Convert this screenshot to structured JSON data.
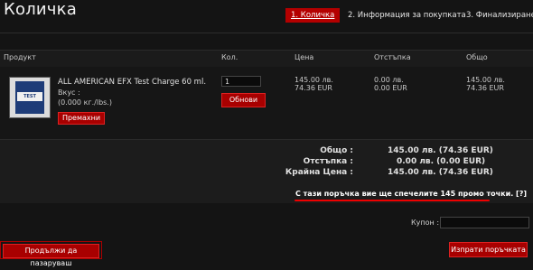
{
  "page": {
    "title": "Количка"
  },
  "steps": [
    {
      "label": "1. Количка",
      "active": true
    },
    {
      "label": "2. Информация за покупката",
      "active": false
    },
    {
      "label": "3. Финализиране",
      "active": false
    }
  ],
  "table": {
    "headers": {
      "product": "Продукт",
      "qty": "Кол.",
      "price": "Цена",
      "discount": "Отстъпка",
      "total": "Общо"
    },
    "row": {
      "name": "ALL AMERICAN EFX Test Charge 60 ml.",
      "taste_label": "Вкус :",
      "weight": "(0.000 кг./lbs.)",
      "remove_label": "Премахни",
      "quantity": "1",
      "update_label": "Обнови",
      "price_bgn": "145.00 лв.",
      "price_eur": "74.36 EUR",
      "discount_bgn": "0.00 лв.",
      "discount_eur": "0.00 EUR",
      "total_bgn": "145.00 лв.",
      "total_eur": "74.36 EUR",
      "image_caption": "TEST CHARGE"
    }
  },
  "summary": {
    "total_label": "Общо :",
    "total_value": "145.00 лв. (74.36 EUR)",
    "discount_label": "Отстъпка :",
    "discount_value": "0.00 лв. (0.00 EUR)",
    "final_label": "Крайна Цена :",
    "final_value": "145.00 лв. (74.36 EUR)",
    "promo_prefix": "С тази поръчка вие ще спечелите ",
    "promo_points": "145",
    "promo_suffix": " промо точки.",
    "promo_help": "[?]"
  },
  "coupon": {
    "label": "Купон :",
    "value": ""
  },
  "buttons": {
    "continue_shopping": "Продължи да пазаруваш",
    "send_order": "Изпрати поръчката"
  },
  "colors": {
    "accent": "#b40000",
    "background": "#141414"
  }
}
